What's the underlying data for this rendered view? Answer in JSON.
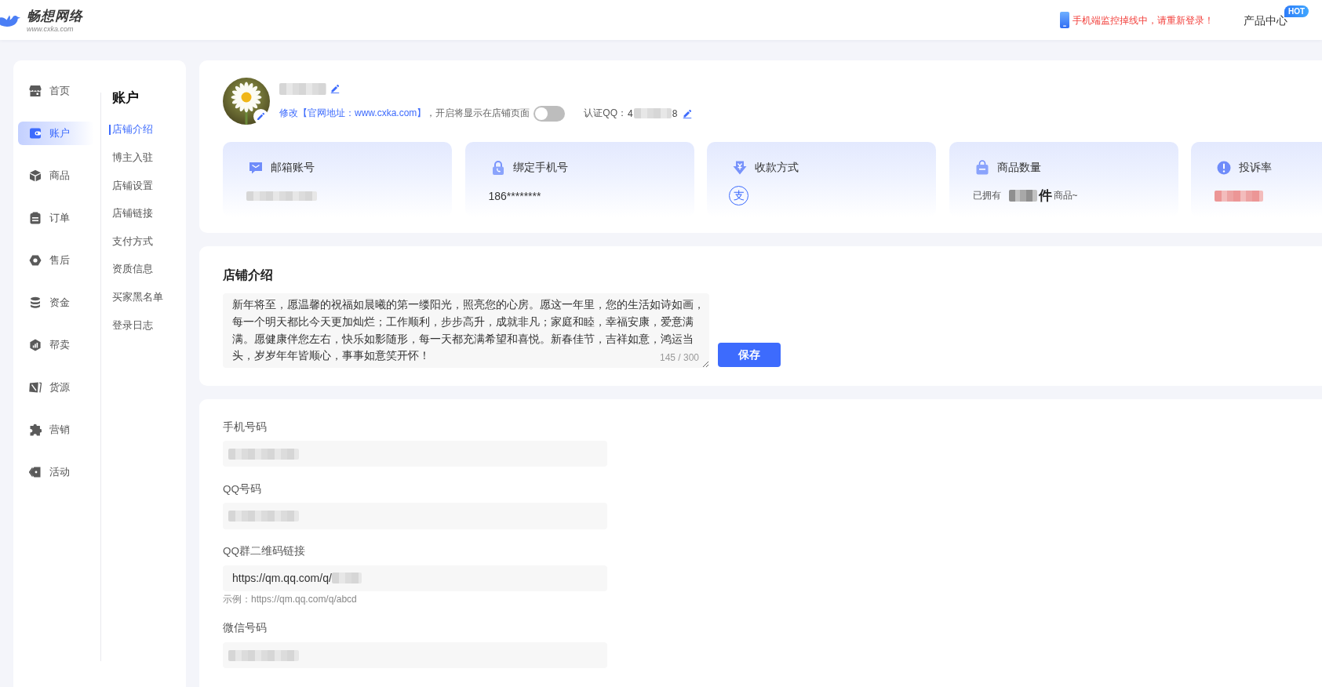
{
  "header": {
    "logo": {
      "name": "畅想网络",
      "url": "www.cxka.com"
    },
    "alert": "手机端监控掉线中，请重新登录！",
    "product_center": {
      "label": "产品中心",
      "badge": "HOT"
    }
  },
  "nav": [
    {
      "label": "首页",
      "selected": false
    },
    {
      "label": "账户",
      "selected": true
    },
    {
      "label": "商品",
      "selected": false
    },
    {
      "label": "订单",
      "selected": false
    },
    {
      "label": "售后",
      "selected": false
    },
    {
      "label": "资金",
      "selected": false
    },
    {
      "label": "帮卖",
      "selected": false
    },
    {
      "label": "货源",
      "selected": false
    },
    {
      "label": "营销",
      "selected": false
    },
    {
      "label": "活动",
      "selected": false
    }
  ],
  "subnav": {
    "title": "账户",
    "items": [
      {
        "label": "店铺介绍",
        "selected": true
      },
      {
        "label": "博主入驻",
        "selected": false
      },
      {
        "label": "店铺设置",
        "selected": false
      },
      {
        "label": "店铺链接",
        "selected": false
      },
      {
        "label": "支付方式",
        "selected": false
      },
      {
        "label": "资质信息",
        "selected": false
      },
      {
        "label": "买家黑名单",
        "selected": false
      },
      {
        "label": "登录日志",
        "selected": false
      }
    ]
  },
  "profile": {
    "name_redacted": true,
    "official_site": {
      "link": "修改【官网地址：www.cxka.com】",
      "note": "，开启将显示在店铺页面",
      "on": false
    },
    "qq": {
      "label": "认证QQ：",
      "value_start": "4",
      "value_end": "8",
      "redacted": true
    }
  },
  "stats": [
    {
      "kind": "email",
      "title": "邮箱账号",
      "redacted": true
    },
    {
      "kind": "phone",
      "title": "绑定手机号",
      "value": "186********"
    },
    {
      "kind": "payment",
      "title": "收款方式",
      "methods": [
        "支"
      ]
    },
    {
      "kind": "goods",
      "title": "商品数量",
      "prefix": "已拥有",
      "unit": "件",
      "suffix": "商品~",
      "redacted": true
    },
    {
      "kind": "complaint",
      "title": "投诉率",
      "redacted": true
    }
  ],
  "intro": {
    "title": "店铺介绍",
    "text": "新年将至，愿温馨的祝福如晨曦的第一缕阳光，照亮您的心房。愿这一年里，您的生活如诗如画，每一个明天都比今天更加灿烂；工作顺利，步步高升，成就非凡；家庭和睦，幸福安康，爱意满满。愿健康伴您左右，快乐如影随形，每一天都充满希望和喜悦。新春佳节，吉祥如意，鸿运当头，岁岁年年皆顺心，事事如意笑开怀！",
    "counter": "145 / 300",
    "save": "保存"
  },
  "form": {
    "fields": [
      {
        "label": "手机号码",
        "redacted": true
      },
      {
        "label": "QQ号码",
        "redacted": true
      },
      {
        "label": "QQ群二维码链接",
        "value": "https://qm.qq.com/q/",
        "redacted": true,
        "hint": "示例：https://qm.qq.com/q/abcd"
      },
      {
        "label": "微信号码",
        "redacted": true
      }
    ]
  }
}
